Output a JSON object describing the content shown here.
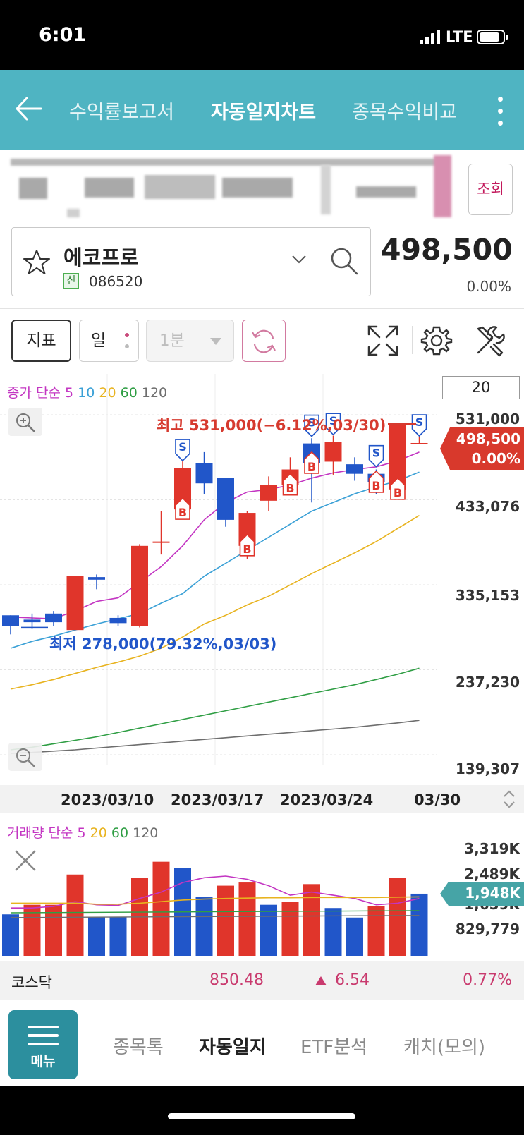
{
  "status_bar": {
    "time": "6:01",
    "network": "LTE"
  },
  "header": {
    "tabs": [
      {
        "label": "수익률보고서"
      },
      {
        "label": "자동일지차트"
      },
      {
        "label": "종목수익비교"
      }
    ],
    "active_tab": "자동일지차트"
  },
  "account": {
    "inquiry_label": "조회"
  },
  "stock": {
    "name": "에코프로",
    "badge": "신",
    "code": "086520",
    "price": "498,500",
    "change_pct": "0.00%"
  },
  "toolbar": {
    "indicator_label": "지표",
    "period_label": "일",
    "interval_label": "1분",
    "count_value": "20"
  },
  "price_chart": {
    "legend_prefix": "종가 단순",
    "ma_periods": [
      "5",
      "10",
      "20",
      "60",
      "120"
    ],
    "high_annotation": "최고 531,000(−6.12%,03/30)",
    "low_annotation": "최저 278,000(79.32%,03/03)",
    "current_price_label": "498,500",
    "current_pct_label": "0.00%",
    "buy_marker": "B",
    "sell_marker": "S"
  },
  "volume_chart": {
    "legend_prefix": "거래량 단순",
    "ma_periods": [
      "5",
      "20",
      "60",
      "120"
    ],
    "current_label": "1,948K"
  },
  "chart_data": [
    {
      "type": "candlestick",
      "title": "종가 단순",
      "y_ticks": [
        "531,000",
        "433,076",
        "335,153",
        "237,230",
        "139,307"
      ],
      "ylim": [
        139307,
        531000
      ],
      "x_ticks": [
        "2023/03/10",
        "2023/03/17",
        "2023/03/24",
        "03/30"
      ],
      "candles": [
        {
          "open": 300000,
          "close": 288000,
          "high": 300000,
          "low": 278000
        },
        {
          "open": 295000,
          "close": 292000,
          "high": 302000,
          "low": 285000
        },
        {
          "open": 302000,
          "close": 292000,
          "high": 305000,
          "low": 288000
        },
        {
          "open": 283000,
          "close": 345000,
          "high": 345000,
          "low": 283000
        },
        {
          "open": 344000,
          "close": 341000,
          "high": 347000,
          "low": 330000
        },
        {
          "open": 297000,
          "close": 291000,
          "high": 300000,
          "low": 288000
        },
        {
          "open": 288000,
          "close": 380000,
          "high": 382000,
          "low": 286000
        },
        {
          "open": 385000,
          "close": 385000,
          "high": 420000,
          "low": 370000
        },
        {
          "open": 422000,
          "close": 470000,
          "high": 480000,
          "low": 415000
        },
        {
          "open": 475000,
          "close": 452000,
          "high": 488000,
          "low": 440000
        },
        {
          "open": 458000,
          "close": 410000,
          "high": 458000,
          "low": 402000
        },
        {
          "open": 380000,
          "close": 418000,
          "high": 420000,
          "low": 365000
        },
        {
          "open": 432000,
          "close": 450000,
          "high": 460000,
          "low": 420000
        },
        {
          "open": 450000,
          "close": 468000,
          "high": 482000,
          "low": 442000
        },
        {
          "open": 498000,
          "close": 475000,
          "high": 504000,
          "low": 430000
        },
        {
          "open": 477000,
          "close": 500000,
          "high": 507000,
          "low": 462000
        },
        {
          "open": 474000,
          "close": 463000,
          "high": 482000,
          "low": 455000
        },
        {
          "open": 463000,
          "close": 453000,
          "high": 468000,
          "low": 440000
        },
        {
          "open": 445000,
          "close": 520000,
          "high": 520000,
          "low": 438000
        },
        {
          "open": 498500,
          "close": 498500,
          "high": 531000,
          "low": 498500
        }
      ],
      "ma": {
        "5": [
          298000,
          297000,
          296000,
          305000,
          316000,
          320000,
          338000,
          356000,
          380000,
          410000,
          430000,
          442000,
          445000,
          450000,
          458000,
          464000,
          468000,
          471000,
          478000,
          488000
        ],
        "10": [
          262000,
          270000,
          276000,
          283000,
          290000,
          296000,
          302000,
          314000,
          325000,
          345000,
          360000,
          375000,
          390000,
          405000,
          420000,
          430000,
          440000,
          448000,
          455000,
          465000
        ],
        "20": [
          215000,
          220000,
          226000,
          233000,
          240000,
          246000,
          253000,
          262000,
          275000,
          290000,
          300000,
          312000,
          322000,
          335000,
          348000,
          360000,
          372000,
          385000,
          400000,
          415000
        ],
        "60": [
          145000,
          148000,
          152000,
          156000,
          160000,
          165000,
          170000,
          175000,
          180000,
          185000,
          190000,
          195000,
          200000,
          205000,
          210000,
          215000,
          220000,
          226000,
          232000,
          239000
        ],
        "120": [
          141000,
          142000,
          143500,
          145000,
          147000,
          149000,
          151000,
          153000,
          155000,
          157000,
          159000,
          161000,
          163000,
          165000,
          167000,
          169000,
          171000,
          173500,
          176000,
          179000
        ]
      },
      "buy_markers": [
        8,
        11,
        13,
        14,
        17,
        18
      ],
      "sell_markers": [
        8,
        14,
        15,
        17,
        19
      ]
    },
    {
      "type": "bar",
      "title": "거래량 단순",
      "y_ticks": [
        "3,319K",
        "2,489K",
        "1,659K",
        "829,779"
      ],
      "ylim": [
        0,
        3319
      ],
      "values": [
        1300,
        1600,
        1600,
        2550,
        1220,
        1220,
        2450,
        2950,
        2750,
        1850,
        2200,
        2300,
        1600,
        1700,
        2250,
        1500,
        1200,
        1550,
        2450,
        1948
      ],
      "colors": [
        "blue",
        "red",
        "red",
        "red",
        "blue",
        "blue",
        "red",
        "red",
        "blue",
        "blue",
        "red",
        "red",
        "blue",
        "red",
        "red",
        "blue",
        "blue",
        "red",
        "red",
        "blue"
      ],
      "ma": {
        "5": [
          1500,
          1500,
          1550,
          1700,
          1600,
          1580,
          1800,
          2000,
          2300,
          2450,
          2500,
          2400,
          2200,
          1900,
          2000,
          1900,
          1800,
          1600,
          1650,
          1800
        ],
        "20": [
          1650,
          1650,
          1650,
          1650,
          1620,
          1620,
          1650,
          1700,
          1750,
          1780,
          1800,
          1810,
          1820,
          1820,
          1830,
          1830,
          1830,
          1830,
          1840,
          1850
        ]
      },
      "ma_flat": {
        "60": 1350,
        "120": 1200
      }
    }
  ],
  "market": {
    "name": "코스닥",
    "value": "850.48",
    "change": "6.54",
    "change_pct": "0.77%"
  },
  "bottom_nav": {
    "menu_label": "메뉴",
    "items": [
      {
        "label": "종목톡"
      },
      {
        "label": "자동일지"
      },
      {
        "label": "ETF분석"
      },
      {
        "label": "캐치(모의)"
      }
    ]
  },
  "colors": {
    "header_bg": "#4fb4c2",
    "up_red": "#e0352b",
    "down_blue": "#2156c9",
    "ma5": "#c335c2",
    "ma10": "#3aa0d6",
    "ma20": "#e8b31f",
    "ma60": "#2f9e44",
    "ma120": "#6e6e6e",
    "menu_bg": "#2c8f9e"
  }
}
